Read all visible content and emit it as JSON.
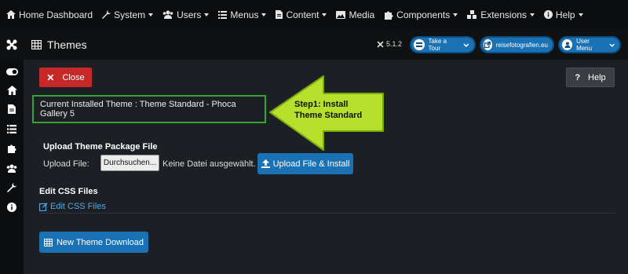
{
  "menu": {
    "items": [
      {
        "label": "Home Dashboard",
        "icon": "home-icon",
        "dropdown": false
      },
      {
        "label": "System",
        "icon": "wrench-icon",
        "dropdown": true
      },
      {
        "label": "Users",
        "icon": "users-icon",
        "dropdown": true
      },
      {
        "label": "Menus",
        "icon": "list-icon",
        "dropdown": true
      },
      {
        "label": "Content",
        "icon": "file-icon",
        "dropdown": true
      },
      {
        "label": "Media",
        "icon": "image-icon",
        "dropdown": false
      },
      {
        "label": "Components",
        "icon": "puzzle-icon",
        "dropdown": true
      },
      {
        "label": "Extensions",
        "icon": "cubes-icon",
        "dropdown": true
      },
      {
        "label": "Help",
        "icon": "info-icon",
        "dropdown": true
      }
    ]
  },
  "header": {
    "title": "Themes",
    "version": "5.1.2",
    "tour_label": "Take a Tour",
    "site_label": "reisefotografien.eu",
    "user_label": "User Menu"
  },
  "toolbar": {
    "close_label": "Close",
    "help_label": "Help"
  },
  "theme": {
    "current": "Current Installed Theme : Theme Standard - Phoca Gallery 5"
  },
  "callout": {
    "line1": "Step1: Install",
    "line2": "Theme Standard"
  },
  "upload": {
    "section_title": "Upload Theme Package File",
    "field_label": "Upload File:",
    "browse_label": "Durchsuchen...",
    "file_status": "Keine Datei ausgewählt.",
    "button_label": "Upload File & Install"
  },
  "css": {
    "section_title": "Edit CSS Files",
    "link_label": "Edit CSS Files"
  },
  "download": {
    "button_label": "New Theme Download"
  },
  "colors": {
    "accent": "#1a72b4",
    "danger": "#c52827",
    "highlight": "#34a636",
    "callout": "#b7e02c",
    "link": "#55a8e6"
  }
}
